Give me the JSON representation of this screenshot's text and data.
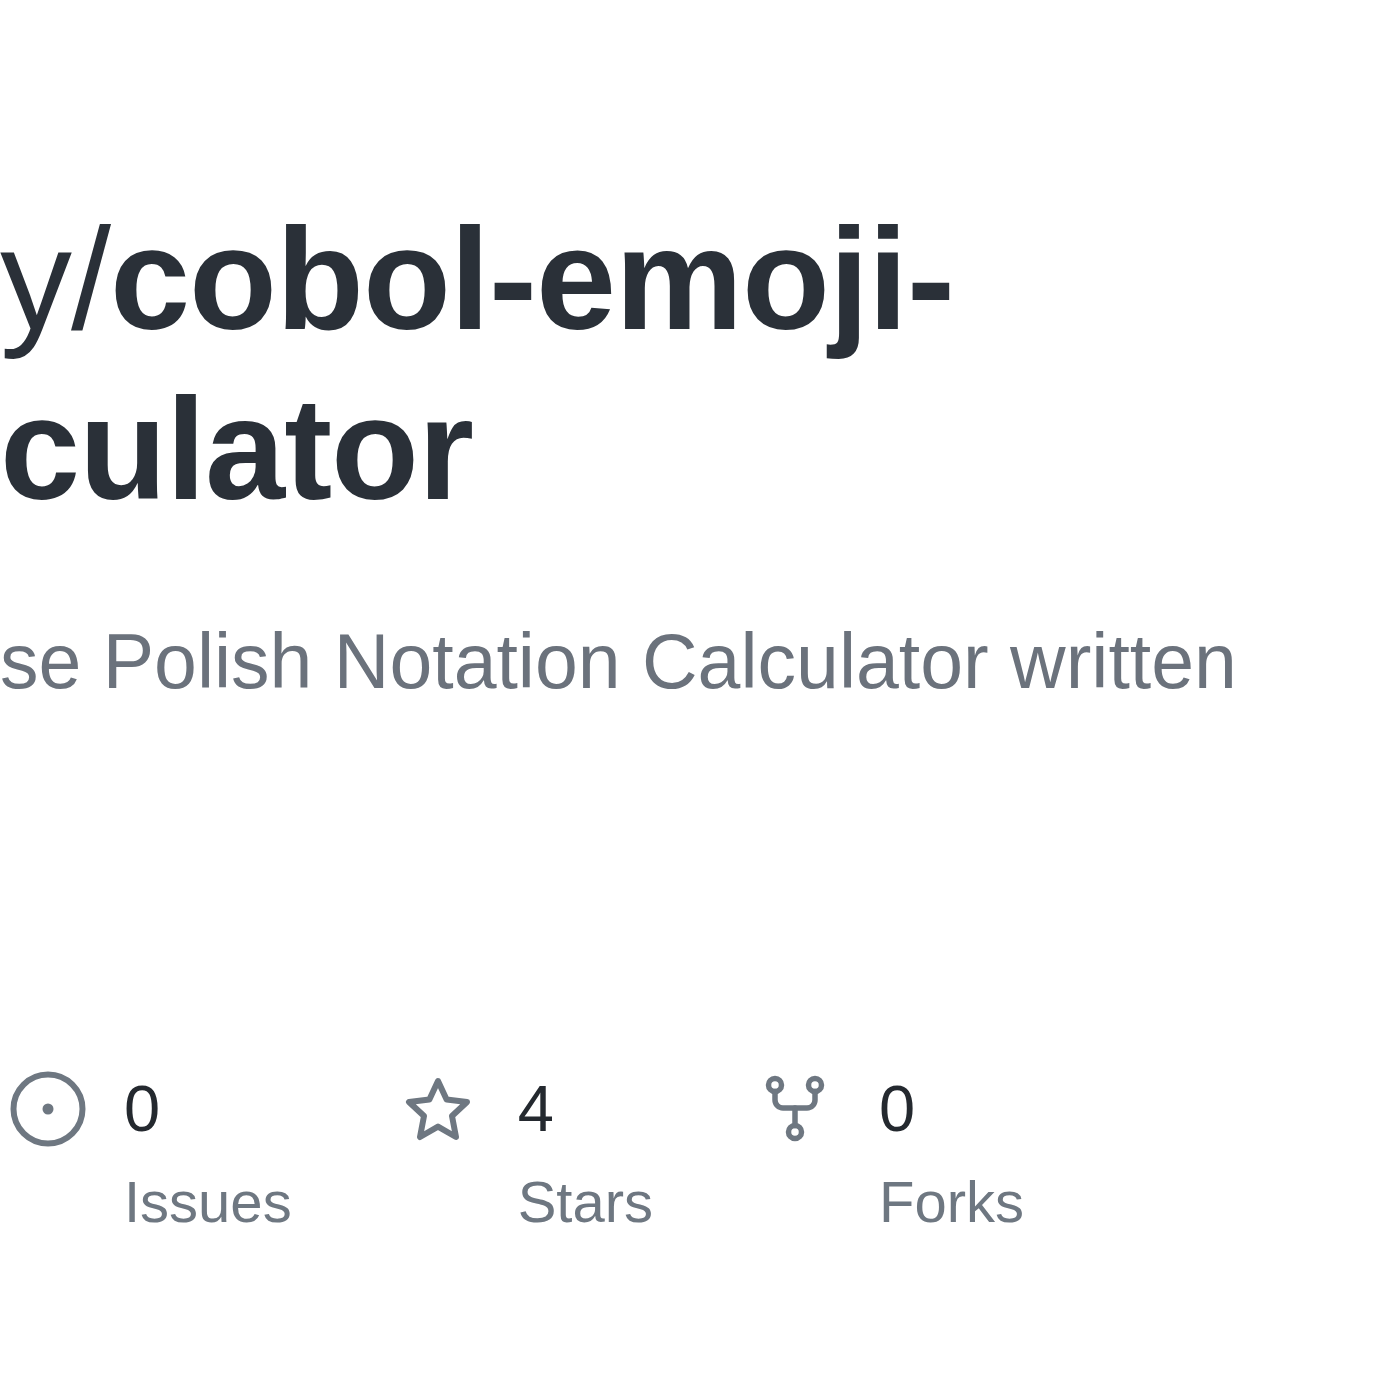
{
  "repository": {
    "owner": "y",
    "separator": "/",
    "name_lines": [
      "cobol-emoji-",
      "culator"
    ]
  },
  "description": "se Polish Notation Calculator written",
  "stats": [
    {
      "kind": "issues",
      "count": "0",
      "label": "Issues"
    },
    {
      "kind": "stars",
      "count": "4",
      "label": "Stars"
    },
    {
      "kind": "forks",
      "count": "0",
      "label": "Forks"
    }
  ]
}
